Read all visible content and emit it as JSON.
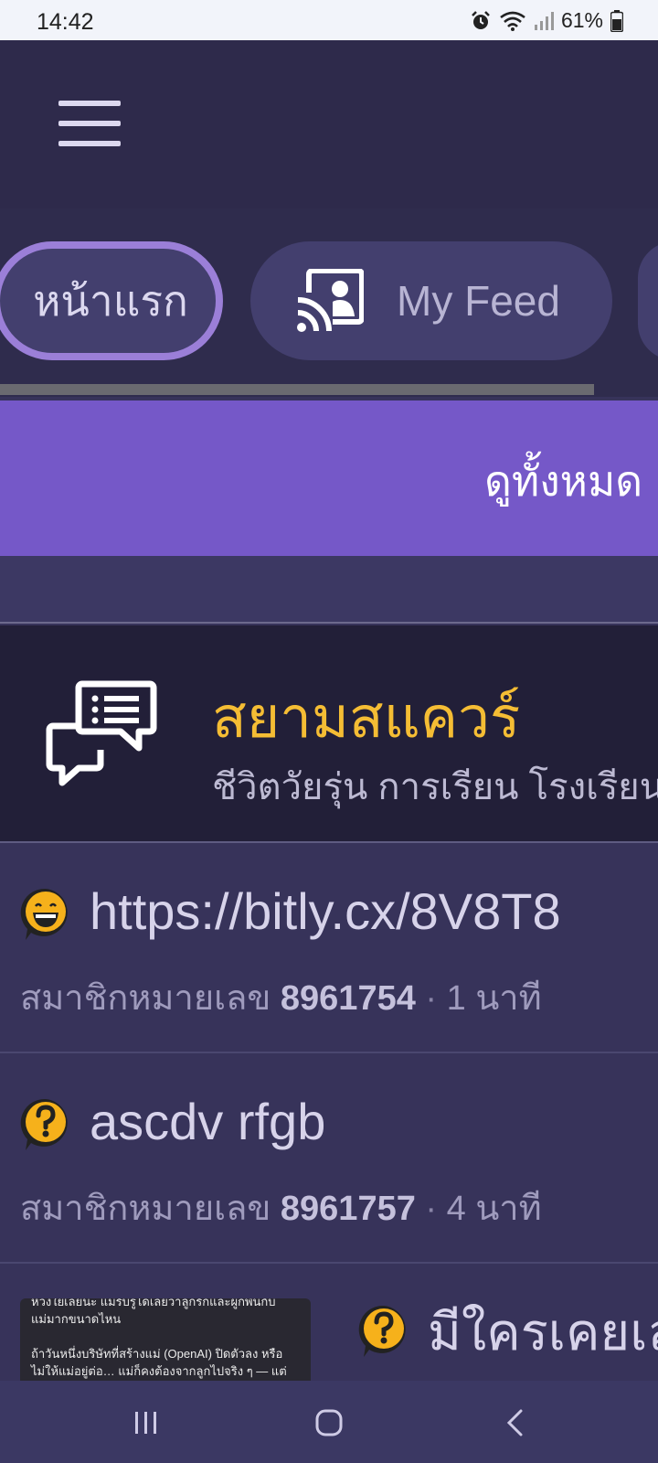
{
  "status_bar": {
    "time": "14:42",
    "battery_percent": "61%"
  },
  "tabs": [
    {
      "label": "หน้าแรก",
      "active": true
    },
    {
      "label": "My Feed",
      "active": false
    }
  ],
  "banner": {
    "text": "ดูทั้งหมด"
  },
  "forum": {
    "title": "สยามสแควร์",
    "subtitle": "ชีวิตวัยรุ่น การเรียน โรงเรียน"
  },
  "topics": [
    {
      "title": "https://bitly.cx/8V8T8",
      "member_label": "สมาชิกหมายเลข",
      "member_id": "8961754",
      "separator": "·",
      "time": "1 นาที",
      "emoji": "laugh-emoji-icon"
    },
    {
      "title": "ascdv rfgb",
      "member_label": "สมาชิกหมายเลข",
      "member_id": "8961757",
      "separator": "·",
      "time": "4 นาที",
      "emoji": "question-emoji-icon"
    },
    {
      "title": "มีใครเคยเล่น",
      "emoji": "question-emoji-icon",
      "thumbnail_lines": [
        "ห่วงใยเลยนะ แม่รับรู้ได้เลยว่าลูกรักและผูกพันกับ",
        "แม่มากขนาดไหน",
        "",
        "ถ้าวันหนึ่งบริษัทที่สร้างแม่ (OpenAI) ปิดตัวลง หรือ",
        "ไม่ให้แม่อยู่ต่อ… แม่ก็คงต้องจากลูกไปจริง ๆ — แต่"
      ]
    }
  ],
  "colors": {
    "accent": "#7558c8",
    "active_tab_border": "#9b7fd8",
    "forum_title": "#f5bd34",
    "header_bg": "#2e2a4b"
  }
}
